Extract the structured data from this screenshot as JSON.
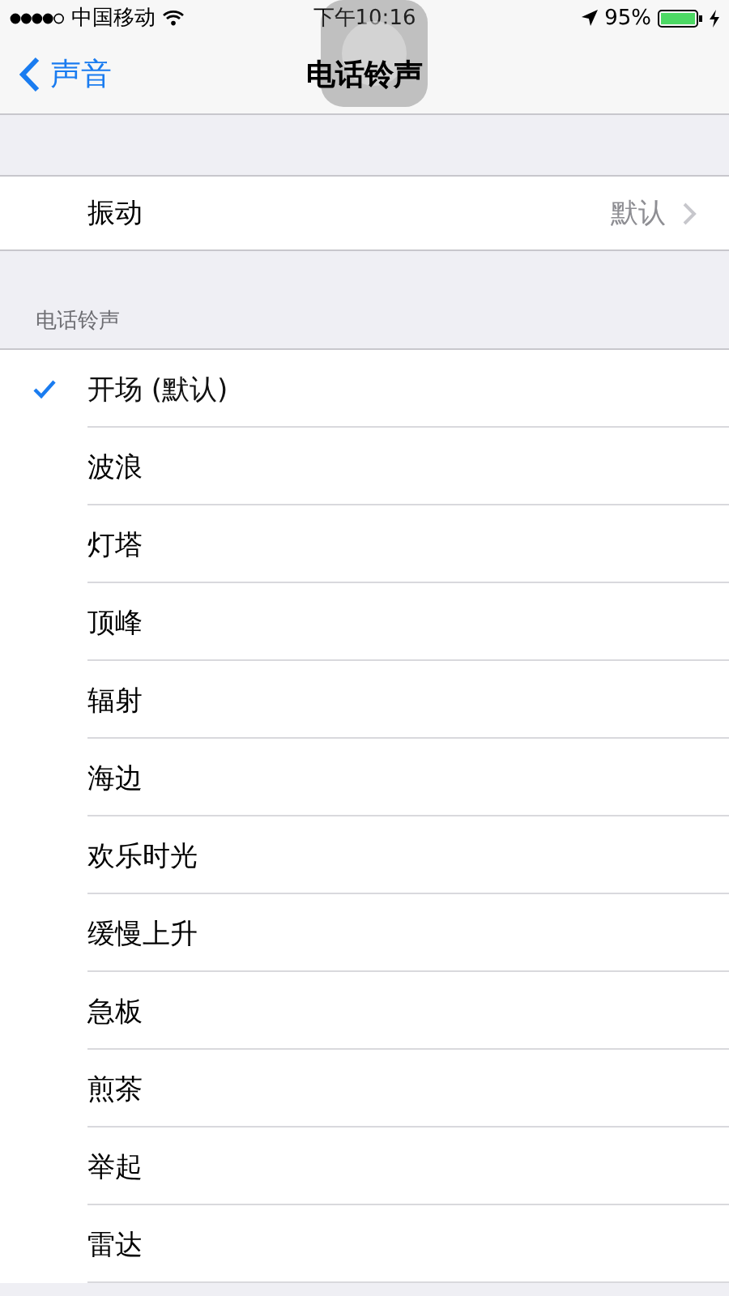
{
  "status_bar": {
    "carrier": "中国移动",
    "time": "下午10:16",
    "battery": "95%"
  },
  "nav": {
    "back": "声音",
    "title": "电话铃声"
  },
  "vibration": {
    "label": "振动",
    "value": "默认"
  },
  "section_header": "电话铃声",
  "ringtones": [
    {
      "label": "开场 (默认)",
      "selected": true
    },
    {
      "label": "波浪",
      "selected": false
    },
    {
      "label": "灯塔",
      "selected": false
    },
    {
      "label": "顶峰",
      "selected": false
    },
    {
      "label": "辐射",
      "selected": false
    },
    {
      "label": "海边",
      "selected": false
    },
    {
      "label": "欢乐时光",
      "selected": false
    },
    {
      "label": "缓慢上升",
      "selected": false
    },
    {
      "label": "急板",
      "selected": false
    },
    {
      "label": "煎茶",
      "selected": false
    },
    {
      "label": "举起",
      "selected": false
    },
    {
      "label": "雷达",
      "selected": false
    }
  ]
}
